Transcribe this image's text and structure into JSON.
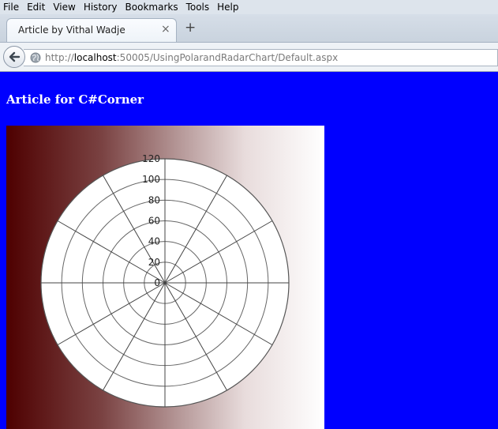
{
  "menu": {
    "items": [
      {
        "label": "File"
      },
      {
        "label": "Edit"
      },
      {
        "label": "View"
      },
      {
        "label": "History"
      },
      {
        "label": "Bookmarks"
      },
      {
        "label": "Tools"
      },
      {
        "label": "Help"
      }
    ]
  },
  "tab": {
    "title": "Article by Vithal Wadje",
    "close_glyph": "×",
    "new_tab_glyph": "+"
  },
  "navbar": {
    "url_prefix": "http://",
    "url_host": "localhost",
    "url_rest": ":50005/UsingPolarandRadarChart/Default.aspx"
  },
  "page": {
    "heading": "Article for C#Corner",
    "background_color": "#0000ff",
    "gradient_dark": "#4e0000",
    "gradient_light": "#ffffff"
  },
  "chart_data": {
    "type": "polar",
    "title": "",
    "series": [],
    "radial_ticks": [
      0,
      20,
      40,
      60,
      80,
      100,
      120
    ],
    "ylim": [
      0,
      120
    ],
    "spoke_count": 12,
    "grid": true
  }
}
